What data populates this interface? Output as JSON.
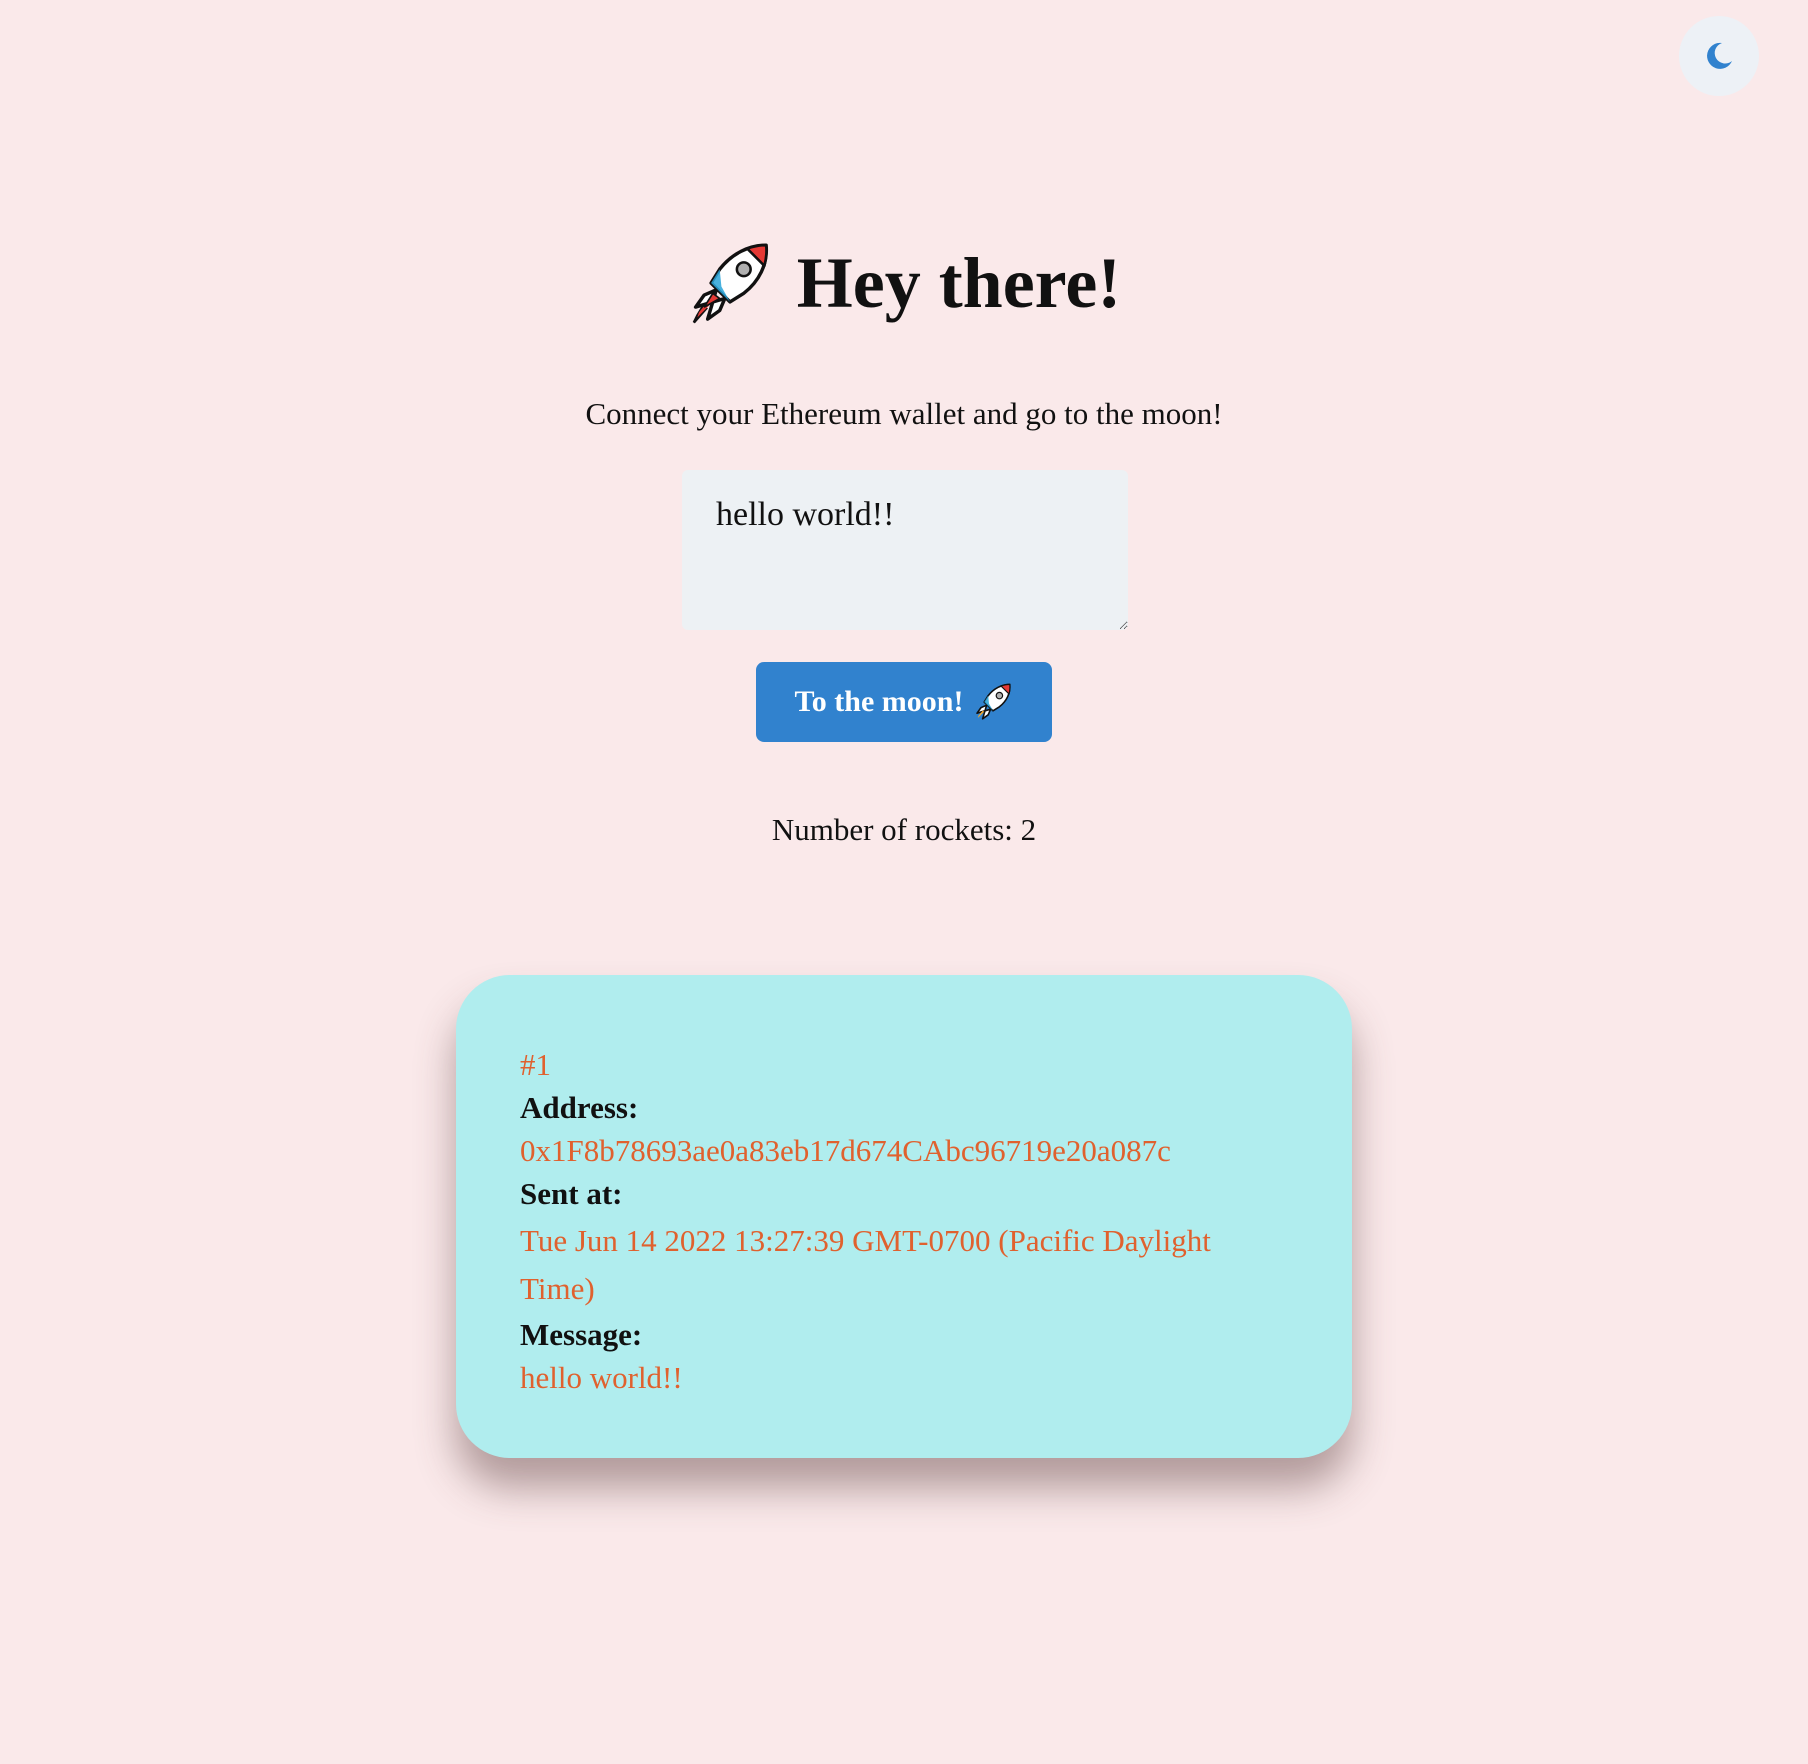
{
  "colors": {
    "page_background": "#fae9ea",
    "accent_blue": "#3182ce",
    "card_background": "#b0edee",
    "card_value_text": "#e0612e",
    "input_background": "#edf1f4"
  },
  "header": {
    "icon": "rocket-icon",
    "title": "Hey there!",
    "subtitle": "Connect your Ethereum wallet and go to the moon!"
  },
  "theme_toggle": {
    "icon": "moon-icon"
  },
  "compose": {
    "message_value": "hello world!!",
    "submit_label": "To the moon!",
    "submit_icon": "rocket-icon"
  },
  "stats": {
    "rocket_count_text": "Number of rockets: 2"
  },
  "messages": [
    {
      "index": "#1",
      "address_label": "Address:",
      "address": "0x1F8b78693ae0a83eb17d674CAbc96719e20a087c",
      "sent_at_label": "Sent at:",
      "sent_at": "Tue Jun 14 2022 13:27:39 GMT-0700 (Pacific Daylight Time)",
      "message_label": "Message:",
      "message": "hello world!!"
    }
  ]
}
